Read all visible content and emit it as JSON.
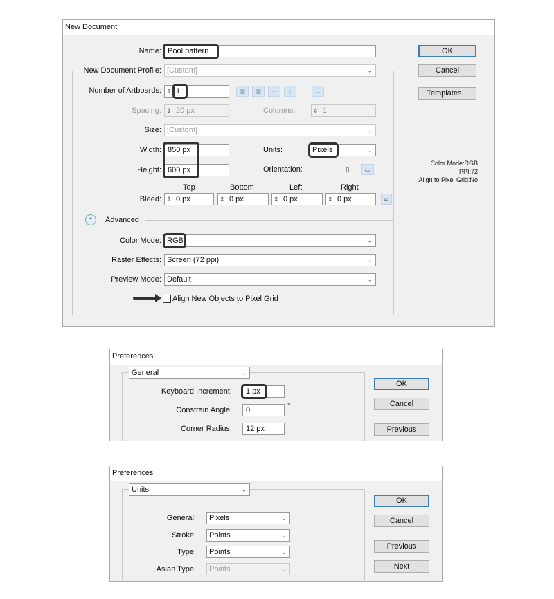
{
  "new_document": {
    "title": "New Document",
    "name_label": "Name:",
    "name_value": "Pool pattern",
    "profile_label": "New Document Profile:",
    "profile_value": "[Custom]",
    "artboards_label": "Number of Artboards:",
    "artboards_value": "1",
    "spacing_label": "Spacing:",
    "spacing_value": "20 px",
    "columns_label": "Columns:",
    "columns_value": "1",
    "size_label": "Size:",
    "size_value": "[Custom]",
    "width_label": "Width:",
    "width_value": "850 px",
    "height_label": "Height:",
    "height_value": "600 px",
    "units_label": "Units:",
    "units_value": "Pixels",
    "orientation_label": "Orientation:",
    "bleed_label": "Bleed:",
    "bleed": [
      {
        "label": "Top",
        "value": "0 px"
      },
      {
        "label": "Bottom",
        "value": "0 px"
      },
      {
        "label": "Left",
        "value": "0 px"
      },
      {
        "label": "Right",
        "value": "0 px"
      }
    ],
    "advanced_label": "Advanced",
    "color_mode_label": "Color Mode:",
    "color_mode_value": "RGB",
    "raster_label": "Raster Effects:",
    "raster_value": "Screen (72 ppi)",
    "preview_label": "Preview Mode:",
    "preview_value": "Default",
    "align_checkbox_label": "Align New Objects to Pixel Grid",
    "align_checked": false,
    "ok": "OK",
    "cancel": "Cancel",
    "templates": "Templates...",
    "info": [
      "Color Mode:RGB",
      "PPI:72",
      "Align to Pixel Grid:No"
    ]
  },
  "prefs_general": {
    "title": "Preferences",
    "section": "General",
    "keyboard_label": "Keyboard Increment:",
    "keyboard_value": "1 px",
    "angle_label": "Constrain Angle:",
    "angle_value": "0",
    "degree": "°",
    "radius_label": "Corner Radius:",
    "radius_value": "12 px",
    "ok": "OK",
    "cancel": "Cancel",
    "previous": "Previous"
  },
  "prefs_units": {
    "title": "Preferences",
    "section": "Units",
    "general_label": "General:",
    "general_value": "Pixels",
    "stroke_label": "Stroke:",
    "stroke_value": "Points",
    "type_label": "Type:",
    "type_value": "Points",
    "asian_label": "Asian Type:",
    "asian_value": "Points",
    "ok": "OK",
    "cancel": "Cancel",
    "previous": "Previous",
    "next": "Next"
  },
  "colors": {
    "accent": "#3c7fb1",
    "highlight": "#333333",
    "dialog_bg": "#f0f0f0"
  }
}
